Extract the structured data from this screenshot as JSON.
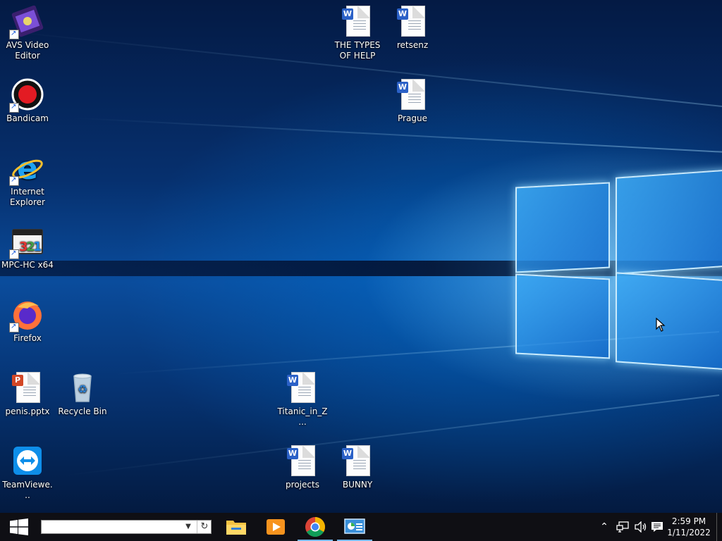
{
  "desktop": {
    "icons": {
      "avs": {
        "label": "AVS Video Editor"
      },
      "bandicam": {
        "label": "Bandicam"
      },
      "ie": {
        "label": "Internet Explorer"
      },
      "mpc": {
        "label": "MPC-HC x64"
      },
      "firefox": {
        "label": "Firefox"
      },
      "pptx": {
        "label": "penis.pptx"
      },
      "recycle": {
        "label": "Recycle Bin"
      },
      "teamviewer": {
        "label": "TeamViewe..."
      },
      "types_of_help": {
        "label": "THE TYPES OF HELP"
      },
      "retsenz": {
        "label": "retsenz"
      },
      "prague": {
        "label": "Prague"
      },
      "titanic": {
        "label": "Titanic_in_Z..."
      },
      "projects": {
        "label": "projects"
      },
      "bunny": {
        "label": "BUNNY"
      }
    }
  },
  "taskbar": {
    "search": {
      "value": "",
      "placeholder": ""
    },
    "clock": {
      "time": "2:59 PM",
      "date": "1/11/2022"
    }
  },
  "colors": {
    "taskbar": "#0f0f14",
    "accent": "#76b9ed",
    "word": "#2b61c7",
    "powerpoint": "#d24726"
  }
}
